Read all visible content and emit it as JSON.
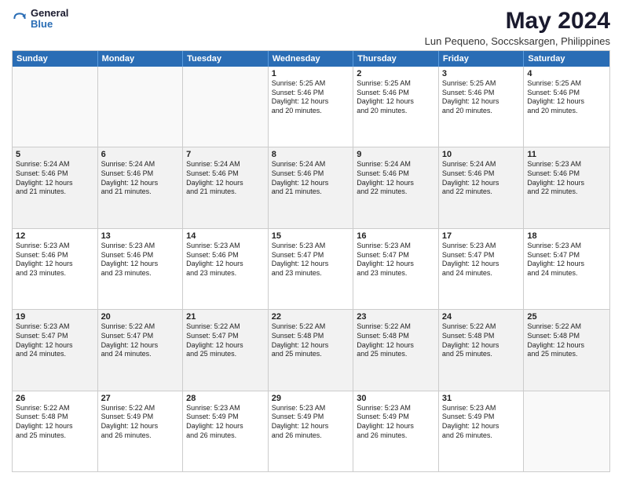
{
  "logo": {
    "general": "General",
    "blue": "Blue"
  },
  "title": {
    "month_year": "May 2024",
    "location": "Lun Pequeno, Soccsksargen, Philippines"
  },
  "header_days": [
    "Sunday",
    "Monday",
    "Tuesday",
    "Wednesday",
    "Thursday",
    "Friday",
    "Saturday"
  ],
  "weeks": [
    [
      {
        "day": "",
        "sunrise": "",
        "sunset": "",
        "daylight": "",
        "empty": true
      },
      {
        "day": "",
        "sunrise": "",
        "sunset": "",
        "daylight": "",
        "empty": true
      },
      {
        "day": "",
        "sunrise": "",
        "sunset": "",
        "daylight": "",
        "empty": true
      },
      {
        "day": "1",
        "sunrise": "Sunrise: 5:25 AM",
        "sunset": "Sunset: 5:46 PM",
        "daylight": "Daylight: 12 hours",
        "daylight2": "and 20 minutes.",
        "empty": false
      },
      {
        "day": "2",
        "sunrise": "Sunrise: 5:25 AM",
        "sunset": "Sunset: 5:46 PM",
        "daylight": "Daylight: 12 hours",
        "daylight2": "and 20 minutes.",
        "empty": false
      },
      {
        "day": "3",
        "sunrise": "Sunrise: 5:25 AM",
        "sunset": "Sunset: 5:46 PM",
        "daylight": "Daylight: 12 hours",
        "daylight2": "and 20 minutes.",
        "empty": false
      },
      {
        "day": "4",
        "sunrise": "Sunrise: 5:25 AM",
        "sunset": "Sunset: 5:46 PM",
        "daylight": "Daylight: 12 hours",
        "daylight2": "and 20 minutes.",
        "empty": false
      }
    ],
    [
      {
        "day": "5",
        "sunrise": "Sunrise: 5:24 AM",
        "sunset": "Sunset: 5:46 PM",
        "daylight": "Daylight: 12 hours",
        "daylight2": "and 21 minutes.",
        "empty": false
      },
      {
        "day": "6",
        "sunrise": "Sunrise: 5:24 AM",
        "sunset": "Sunset: 5:46 PM",
        "daylight": "Daylight: 12 hours",
        "daylight2": "and 21 minutes.",
        "empty": false
      },
      {
        "day": "7",
        "sunrise": "Sunrise: 5:24 AM",
        "sunset": "Sunset: 5:46 PM",
        "daylight": "Daylight: 12 hours",
        "daylight2": "and 21 minutes.",
        "empty": false
      },
      {
        "day": "8",
        "sunrise": "Sunrise: 5:24 AM",
        "sunset": "Sunset: 5:46 PM",
        "daylight": "Daylight: 12 hours",
        "daylight2": "and 21 minutes.",
        "empty": false
      },
      {
        "day": "9",
        "sunrise": "Sunrise: 5:24 AM",
        "sunset": "Sunset: 5:46 PM",
        "daylight": "Daylight: 12 hours",
        "daylight2": "and 22 minutes.",
        "empty": false
      },
      {
        "day": "10",
        "sunrise": "Sunrise: 5:24 AM",
        "sunset": "Sunset: 5:46 PM",
        "daylight": "Daylight: 12 hours",
        "daylight2": "and 22 minutes.",
        "empty": false
      },
      {
        "day": "11",
        "sunrise": "Sunrise: 5:23 AM",
        "sunset": "Sunset: 5:46 PM",
        "daylight": "Daylight: 12 hours",
        "daylight2": "and 22 minutes.",
        "empty": false
      }
    ],
    [
      {
        "day": "12",
        "sunrise": "Sunrise: 5:23 AM",
        "sunset": "Sunset: 5:46 PM",
        "daylight": "Daylight: 12 hours",
        "daylight2": "and 23 minutes.",
        "empty": false
      },
      {
        "day": "13",
        "sunrise": "Sunrise: 5:23 AM",
        "sunset": "Sunset: 5:46 PM",
        "daylight": "Daylight: 12 hours",
        "daylight2": "and 23 minutes.",
        "empty": false
      },
      {
        "day": "14",
        "sunrise": "Sunrise: 5:23 AM",
        "sunset": "Sunset: 5:46 PM",
        "daylight": "Daylight: 12 hours",
        "daylight2": "and 23 minutes.",
        "empty": false
      },
      {
        "day": "15",
        "sunrise": "Sunrise: 5:23 AM",
        "sunset": "Sunset: 5:47 PM",
        "daylight": "Daylight: 12 hours",
        "daylight2": "and 23 minutes.",
        "empty": false
      },
      {
        "day": "16",
        "sunrise": "Sunrise: 5:23 AM",
        "sunset": "Sunset: 5:47 PM",
        "daylight": "Daylight: 12 hours",
        "daylight2": "and 23 minutes.",
        "empty": false
      },
      {
        "day": "17",
        "sunrise": "Sunrise: 5:23 AM",
        "sunset": "Sunset: 5:47 PM",
        "daylight": "Daylight: 12 hours",
        "daylight2": "and 24 minutes.",
        "empty": false
      },
      {
        "day": "18",
        "sunrise": "Sunrise: 5:23 AM",
        "sunset": "Sunset: 5:47 PM",
        "daylight": "Daylight: 12 hours",
        "daylight2": "and 24 minutes.",
        "empty": false
      }
    ],
    [
      {
        "day": "19",
        "sunrise": "Sunrise: 5:23 AM",
        "sunset": "Sunset: 5:47 PM",
        "daylight": "Daylight: 12 hours",
        "daylight2": "and 24 minutes.",
        "empty": false
      },
      {
        "day": "20",
        "sunrise": "Sunrise: 5:22 AM",
        "sunset": "Sunset: 5:47 PM",
        "daylight": "Daylight: 12 hours",
        "daylight2": "and 24 minutes.",
        "empty": false
      },
      {
        "day": "21",
        "sunrise": "Sunrise: 5:22 AM",
        "sunset": "Sunset: 5:47 PM",
        "daylight": "Daylight: 12 hours",
        "daylight2": "and 25 minutes.",
        "empty": false
      },
      {
        "day": "22",
        "sunrise": "Sunrise: 5:22 AM",
        "sunset": "Sunset: 5:48 PM",
        "daylight": "Daylight: 12 hours",
        "daylight2": "and 25 minutes.",
        "empty": false
      },
      {
        "day": "23",
        "sunrise": "Sunrise: 5:22 AM",
        "sunset": "Sunset: 5:48 PM",
        "daylight": "Daylight: 12 hours",
        "daylight2": "and 25 minutes.",
        "empty": false
      },
      {
        "day": "24",
        "sunrise": "Sunrise: 5:22 AM",
        "sunset": "Sunset: 5:48 PM",
        "daylight": "Daylight: 12 hours",
        "daylight2": "and 25 minutes.",
        "empty": false
      },
      {
        "day": "25",
        "sunrise": "Sunrise: 5:22 AM",
        "sunset": "Sunset: 5:48 PM",
        "daylight": "Daylight: 12 hours",
        "daylight2": "and 25 minutes.",
        "empty": false
      }
    ],
    [
      {
        "day": "26",
        "sunrise": "Sunrise: 5:22 AM",
        "sunset": "Sunset: 5:48 PM",
        "daylight": "Daylight: 12 hours",
        "daylight2": "and 25 minutes.",
        "empty": false
      },
      {
        "day": "27",
        "sunrise": "Sunrise: 5:22 AM",
        "sunset": "Sunset: 5:49 PM",
        "daylight": "Daylight: 12 hours",
        "daylight2": "and 26 minutes.",
        "empty": false
      },
      {
        "day": "28",
        "sunrise": "Sunrise: 5:23 AM",
        "sunset": "Sunset: 5:49 PM",
        "daylight": "Daylight: 12 hours",
        "daylight2": "and 26 minutes.",
        "empty": false
      },
      {
        "day": "29",
        "sunrise": "Sunrise: 5:23 AM",
        "sunset": "Sunset: 5:49 PM",
        "daylight": "Daylight: 12 hours",
        "daylight2": "and 26 minutes.",
        "empty": false
      },
      {
        "day": "30",
        "sunrise": "Sunrise: 5:23 AM",
        "sunset": "Sunset: 5:49 PM",
        "daylight": "Daylight: 12 hours",
        "daylight2": "and 26 minutes.",
        "empty": false
      },
      {
        "day": "31",
        "sunrise": "Sunrise: 5:23 AM",
        "sunset": "Sunset: 5:49 PM",
        "daylight": "Daylight: 12 hours",
        "daylight2": "and 26 minutes.",
        "empty": false
      },
      {
        "day": "",
        "sunrise": "",
        "sunset": "",
        "daylight": "",
        "daylight2": "",
        "empty": true
      }
    ]
  ]
}
